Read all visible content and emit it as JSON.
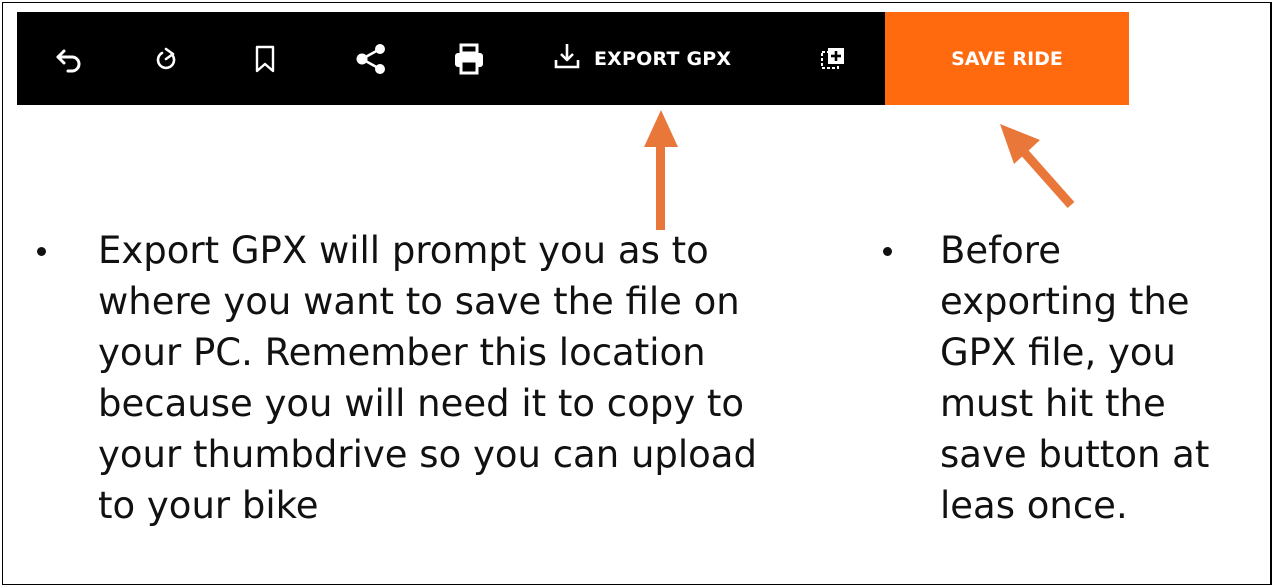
{
  "toolbar": {
    "background": "#000000",
    "icons": [
      "undo-icon",
      "redo-icon",
      "bookmark-icon",
      "share-icon",
      "print-icon",
      "download-icon",
      "add-to-collection-icon"
    ],
    "export_label": "EXPORT GPX"
  },
  "save_button": {
    "label": "SAVE RIDE",
    "color": "#FF6A0E"
  },
  "annotations": {
    "arrow_color": "#E9773A",
    "left_bullet": "Export GPX will prompt you as to where you want to save the file on your PC. Remember this location because you will need it to copy to your thumbdrive so you can upload to your bike",
    "left_lines": [
      "Export GPX will prompt you as to",
      "where you want to save the file on",
      "your PC. Remember this location",
      "because you will need it to copy to",
      "your thumbdrive so you can upload",
      "to your bike"
    ],
    "right_lines": [
      "Before",
      "exporting the",
      "GPX file, you",
      "must hit the",
      "save button at",
      "leas once."
    ]
  }
}
